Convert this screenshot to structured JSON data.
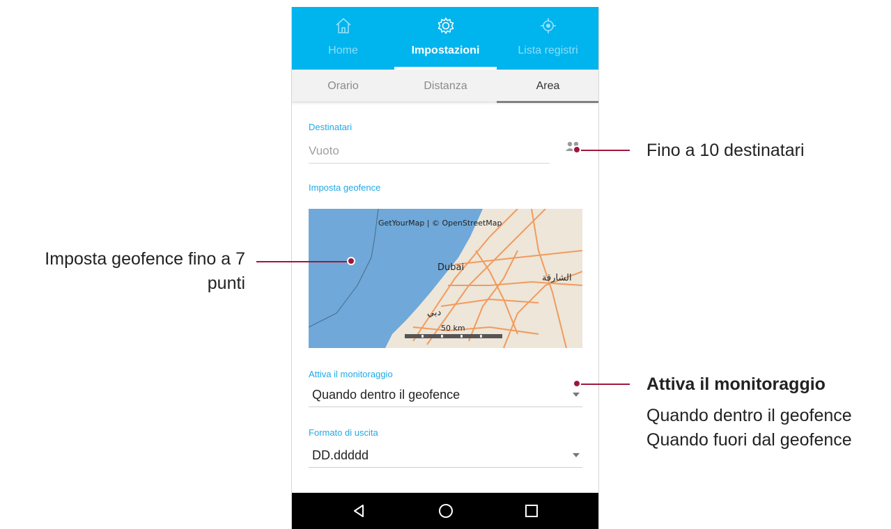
{
  "top_nav": {
    "tabs": [
      {
        "label": "Home",
        "icon": "home-icon"
      },
      {
        "label": "Impostazioni",
        "icon": "gear-icon"
      },
      {
        "label": "Lista registri",
        "icon": "location-target-icon"
      }
    ],
    "active_index": 1,
    "color": "#00b4ee"
  },
  "sub_tabs": {
    "tabs": [
      {
        "label": "Orario"
      },
      {
        "label": "Distanza"
      },
      {
        "label": "Area"
      }
    ],
    "active_index": 2
  },
  "form": {
    "recipients": {
      "label": "Destinatari",
      "placeholder": "Vuoto",
      "icon": "people-icon"
    },
    "geofence": {
      "label": "Imposta geofence",
      "map": {
        "attribution": "GetYourMap | © OpenStreetMap",
        "city_label_latin": "Dubai",
        "city_label_arabic": "دبي",
        "sharjah_label": "الشارقة",
        "scale_label": "50 km",
        "water_color": "#6fa8d9",
        "land_color": "#ede6d9",
        "road_color": "#f29a5c"
      }
    },
    "monitoring": {
      "label": "Attiva il monitoraggio",
      "value": "Quando dentro il geofence"
    },
    "output_format": {
      "label": "Formato di uscita",
      "value": "DD.ddddd"
    }
  },
  "system_nav": {
    "back": "back-icon",
    "home": "home-circle-icon",
    "recents": "recents-square-icon"
  },
  "annotations": {
    "recipients_note": "Fino a 10 destinatari",
    "geofence_note_line1": "Imposta geofence fino a 7",
    "geofence_note_line2": "punti",
    "monitoring_title": "Attiva il monitoraggio",
    "monitoring_option1": "Quando dentro il geofence",
    "monitoring_option2": "Quando fuori dal geofence",
    "accent_color": "#a0163a"
  }
}
